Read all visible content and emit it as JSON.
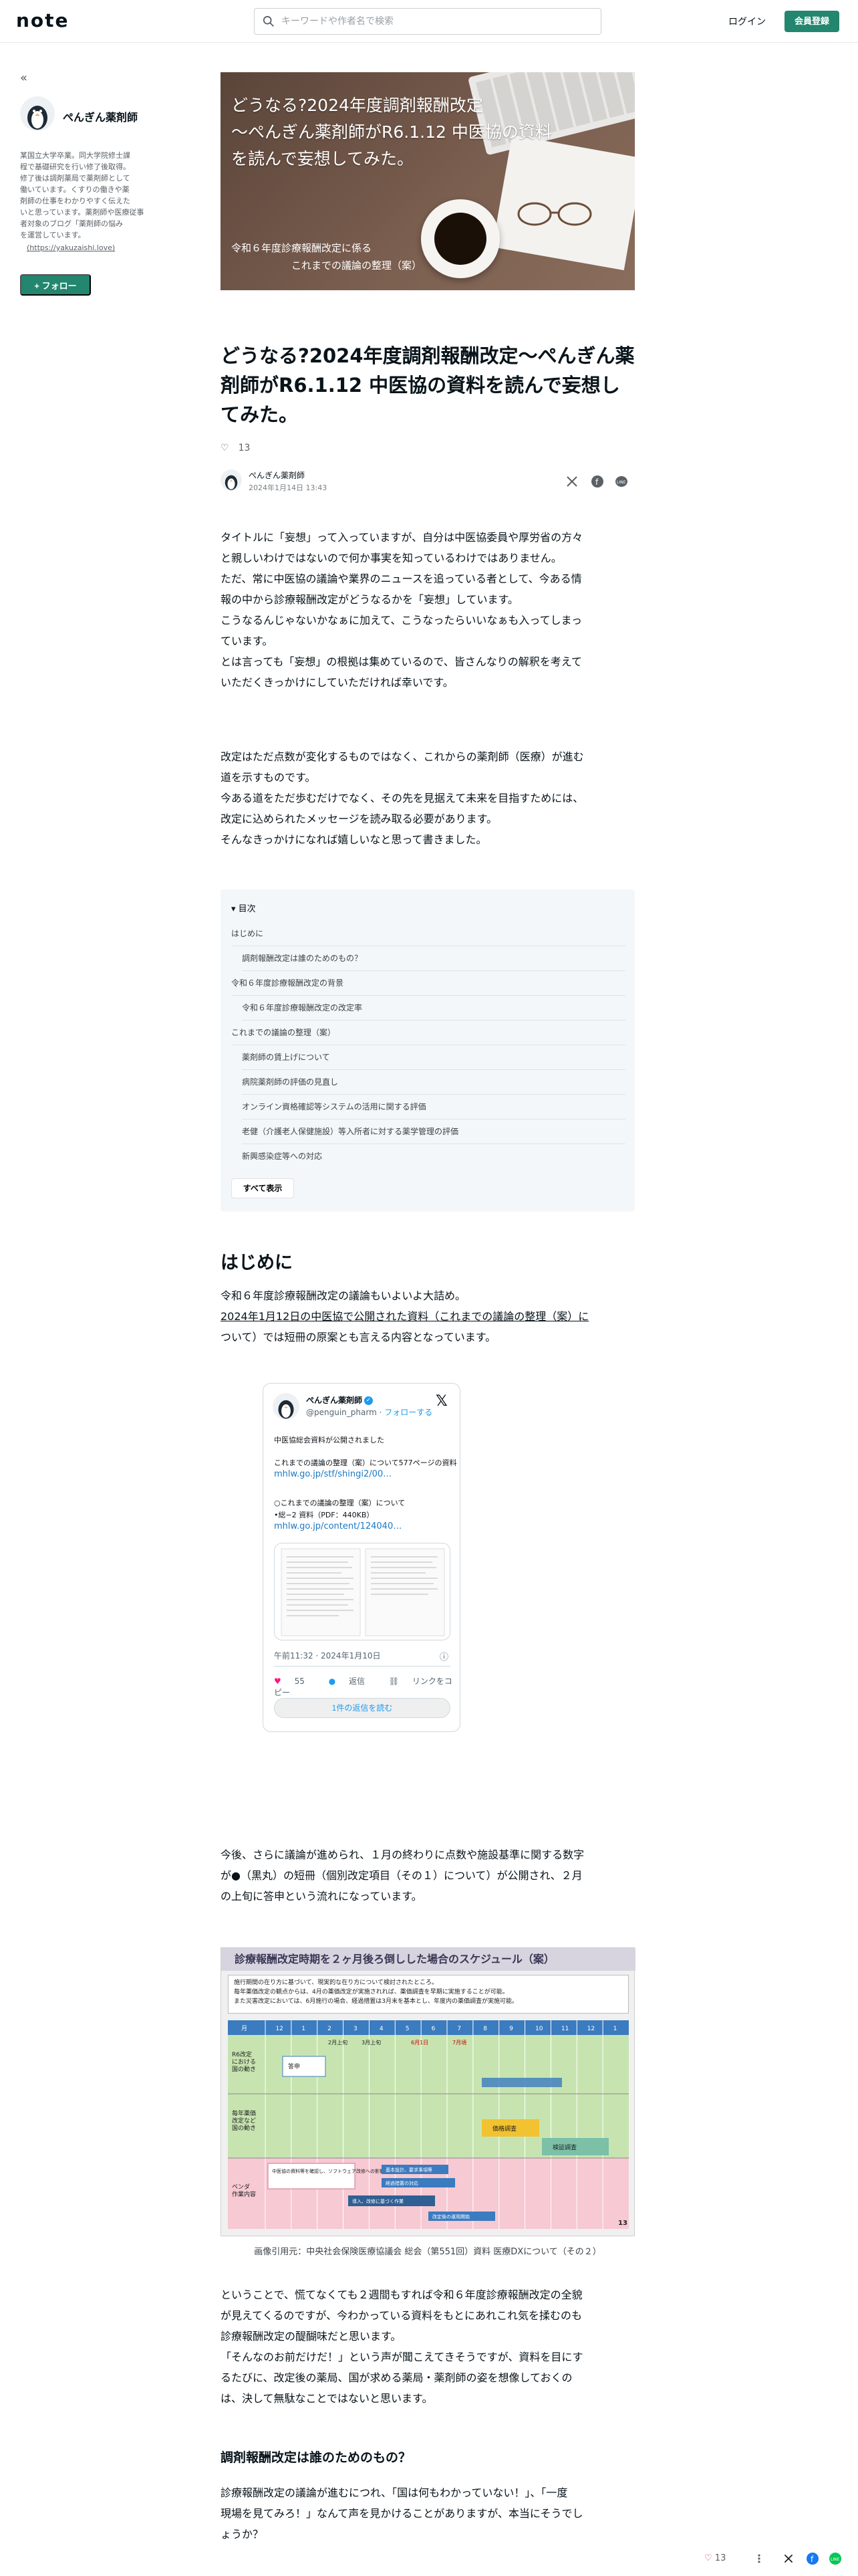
{
  "header": {
    "logo": "note",
    "search_placeholder": "キーワードや作者名で検索",
    "login": "ログイン",
    "signup": "会員登録"
  },
  "sidebar": {
    "collapse_icon": "«",
    "author_name": "ぺんぎん薬剤師",
    "bio_lines": [
      "某国立大学卒業。同大学院修士課",
      "程で基礎研究を行い修了後取得。",
      "修了後は調剤薬局で薬剤師として",
      "働いています。くすりの働きや薬",
      "剤師の仕事をわかりやすく伝えた",
      "いと思っています。薬剤師や医療従事",
      "者対象のブログ「薬剤師の悩み",
      "を運営しています。"
    ],
    "bio_link": "(https://yakuzaishi.love)",
    "follow": "+ フォロー"
  },
  "hero": {
    "line1": "どうなる?2024年度調剤報酬改定",
    "line2": "〜ぺんぎん薬剤師がR6.1.12 中医協の資料",
    "line3": "を読んで妄想してみた。",
    "sub1": "令和６年度診療報酬改定に係る",
    "sub2": "これまでの議論の整理（案）"
  },
  "article": {
    "title": "どうなる?2024年度調剤報酬改定〜ぺんぎん薬剤師がR6.1.12 中医協の資料を読んで妄想してみた。",
    "likes": "13",
    "author": "ぺんぎん薬剤師",
    "date": "2024年1月14日 13:43",
    "p1": [
      "タイトルに「妄想」って入っていますが、自分は中医協委員や厚労省の方々",
      "と親しいわけではないので何か事実を知っているわけではありません。",
      "ただ、常に中医協の議論や業界のニュースを追っている者として、今ある情",
      "報の中から診療報酬改定がどうなるかを「妄想」しています。",
      "こうなるんじゃないかなぁに加えて、こうなったらいいなぁも入ってしまっ",
      "ています。",
      "とは言っても「妄想」の根拠は集めているので、皆さんなりの解釈を考えて",
      "いただくきっかけにしていただければ幸いです。"
    ],
    "p2": [
      "改定はただ点数が変化するものではなく、これからの薬剤師（医療）が進む",
      "道を示すものです。",
      "今ある道をただ歩むだけでなく、その先を見据えて未来を目指すためには、",
      "改定に込められたメッセージを読み取る必要があります。",
      "そんなきっかけになれば嬉しいなと思って書きました。"
    ],
    "toc_title": "目次",
    "toc": [
      {
        "label": "はじめに",
        "sub": false
      },
      {
        "label": "調剤報酬改定は誰のためのもの？",
        "sub": true
      },
      {
        "label": "令和６年度診療報酬改定の背景",
        "sub": false
      },
      {
        "label": "令和６年度診療報酬改定の改定率",
        "sub": true
      },
      {
        "label": "これまでの議論の整理（案）",
        "sub": false
      },
      {
        "label": "薬剤師の賃上げについて",
        "sub": true
      },
      {
        "label": "病院薬剤師の評価の見直し",
        "sub": true
      },
      {
        "label": "オンライン資格確認等システムの活用に関する評価",
        "sub": true
      },
      {
        "label": "老健（介護老人保健施設）等入所者に対する薬学管理の評価",
        "sub": true
      },
      {
        "label": "新興感染症等への対応",
        "sub": true
      }
    ],
    "toc_more": "すべて表示",
    "h_intro": "はじめに",
    "p3": [
      "令和６年度診療報酬改定の議論もいよいよ大詰め。",
      "2024年1月12日の中医協で公開された資料（これまでの議論の整理（案）に",
      "ついて）では短冊の原案とも言える内容となっています。"
    ],
    "p4": [
      "今後、さらに議論が進められ、１月の終わりに点数や施設基準に関する数字",
      "が●（黒丸）の短冊（個別改定項目（その１）について）が公開され、２月",
      "の上旬に答申という流れになっています。"
    ],
    "fig_caption": "画像引用元：中央社会保険医療協議会 総会（第551回）資料 医療DXについて（その２）",
    "p5": [
      "ということで、慌てなくても２週間もすれば令和６年度診療報酬改定の全貌",
      "が見えてくるのですが、今わかっている資料をもとにあれこれ気を揉むのも",
      "診療報酬改定の醍醐味だと思います。",
      "「そんなのお前だけだ！」という声が聞こえてきそうですが、資料を目にす",
      "るたびに、改定後の薬局、国が求める薬局・薬剤師の姿を想像しておくの",
      "は、決して無駄なことではないと思います。"
    ],
    "h_sub": "調剤報酬改定は誰のためのもの？",
    "p6": [
      "診療報酬改定の議論が進むにつれ、「国は何もわかっていない！」、「一度",
      "現場を見てみろ！」なんて声を見かけることがありますが、本当にそうでし",
      "ょうか？"
    ]
  },
  "tweet": {
    "name": "ぺんぎん薬剤師",
    "handle": "@penguin_pharm",
    "follow": "フォローする",
    "line1": "中医協総会資料が公開されました",
    "line2": "これまでの議論の整理（案）について577ページの資料",
    "link1": "mhlw.go.jp/stf/shingi2/00…",
    "line3": "○これまでの議論の整理（案）について",
    "line4": "•総−2 資料（PDF：440KB）",
    "link2": "mhlw.go.jp/content/124040…",
    "time": "午前11:32 · 2024年1月10日",
    "likes": "55",
    "reply": "返信",
    "copy": "リンクをコピー",
    "more": "1件の返信を読む"
  },
  "schedule": {
    "title": "診療報酬改定時期を２ヶ月後ろ倒しした場合のスケジュール（案）",
    "notes": [
      "施行期間の在り方に基づいて、現実的な在り方について検討されたところ。",
      "毎年薬価改定の観点からは、4月の薬価改定が実施されれば、薬価調査を早期に実施することが可能。",
      "また災害改定においては、6月施行の場合、経過措置は3月末を基本とし、年度内の薬価調査が実施可能。"
    ],
    "months": [
      "月",
      "12",
      "1",
      "2",
      "3",
      "4",
      "5",
      "6",
      "7",
      "8",
      "9",
      "10",
      "11",
      "12",
      "1"
    ],
    "rows": [
      {
        "label": "R6改定\nにおける\n国の動き",
        "color": "#c7e4b0"
      },
      {
        "label": "毎年薬価\n改定など\n国の改定\nにおける\n動き",
        "color": "#c7e4b0"
      },
      {
        "label": "ベンダ\n作業内容",
        "color": "#f6c9d3"
      }
    ],
    "events": {
      "e1": "答申",
      "e2": "2月上旬\n中医協諮問",
      "e3": "3月上旬\n関係告示等\n3月下旬\n電子点数表",
      "e4": "6月1日\n施行",
      "e5": "7月頃\n報酬調査",
      "e6": "薬価調査",
      "e7": "価格調査",
      "e8": "検証調査",
      "e9": "中医協の資料等を確認し、ソフトウェア改修への影響を見積る",
      "e10": "基本設計、要求事項等",
      "e11": "経過措置の対応",
      "e12": "改定後の運用開始",
      "e13": "稼働",
      "e14": "テスト",
      "e15": "一部の改定作業",
      "e16": "導入、改修に基づく作業"
    },
    "page_num": "13"
  },
  "colors": {
    "brand": "#23866e",
    "text": "#08131a",
    "muted": "#5a6066",
    "link": "#1d9bf0"
  }
}
